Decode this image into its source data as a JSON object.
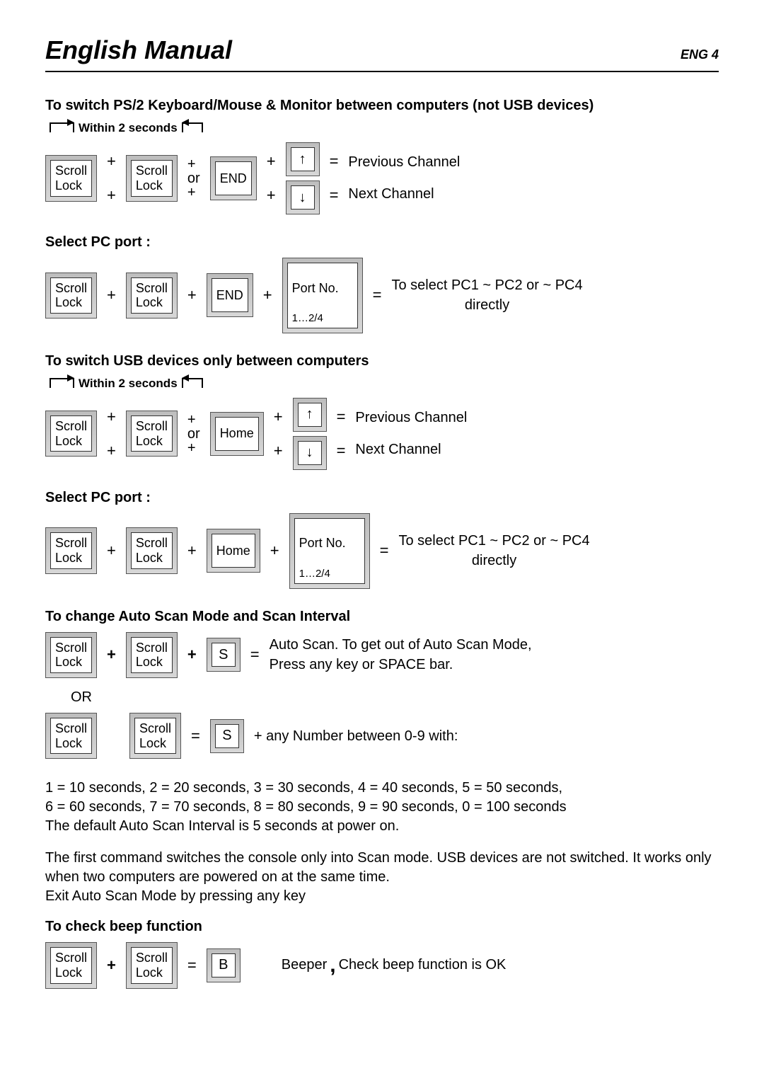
{
  "header": {
    "title": "English Manual",
    "page": "ENG 4"
  },
  "keys": {
    "scroll_lock": "Scroll\nLock",
    "end": "END",
    "home": "Home",
    "port_no": "Port No.",
    "port_no_sub": "1…2/4",
    "s": "S",
    "b": "B"
  },
  "glyphs": {
    "plus": "+",
    "plus_or_plus": "+\nor\n+",
    "eq": "=",
    "or_word": "or",
    "or_upper": "OR",
    "comma": ","
  },
  "labels": {
    "within2s": "Within 2 seconds",
    "prev_channel": "Previous Channel",
    "next_channel": "Next Channel",
    "select_port_result": "To select PC1 ~ PC2 or ~ PC4\ndirectly",
    "auto_scan_line": "Auto Scan.   To get out of Auto Scan Mode,\nPress any key or SPACE bar.",
    "scan_number_line": "+ any Number between 0-9 with:",
    "beeper": "Beeper",
    "beeper_result": "Check beep function is OK"
  },
  "sections": {
    "s1": "To switch PS/2 Keyboard/Mouse & Monitor between computers (not USB devices)",
    "s2": "Select PC port :",
    "s3": "To switch USB devices only between computers",
    "s4": "Select PC port :",
    "s5": "To change Auto Scan Mode and Scan Interval",
    "s6": "To check beep function"
  },
  "paragraphs": {
    "p1": "1 = 10 seconds, 2 = 20 seconds, 3 = 30 seconds, 4 = 40 seconds, 5 = 50 seconds,\n6 = 60 seconds, 7 = 70 seconds, 8 = 80 seconds, 9 = 90 seconds, 0 = 100 seconds\nThe default Auto Scan Interval is 5 seconds at power on.",
    "p2": "The first command switches the console only into Scan mode. USB devices are not switched. It works only when two computers are powered on at the same time.\nExit Auto Scan Mode by pressing any key"
  }
}
